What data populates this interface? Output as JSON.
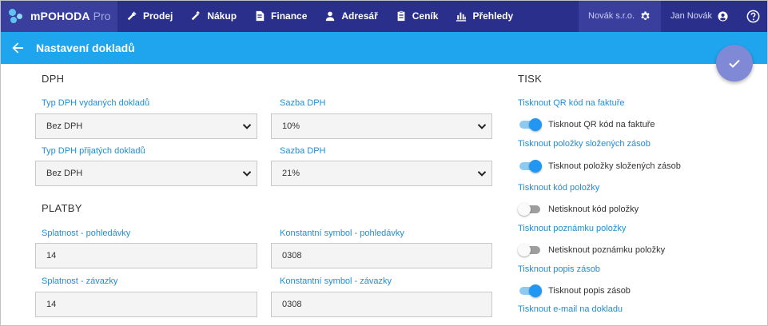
{
  "app": {
    "name": "mPOHODA",
    "edition": "Pro"
  },
  "nav": [
    {
      "label": "Prodej",
      "icon": "sales-icon"
    },
    {
      "label": "Nákup",
      "icon": "purchase-icon"
    },
    {
      "label": "Finance",
      "icon": "finance-icon"
    },
    {
      "label": "Adresář",
      "icon": "person-icon"
    },
    {
      "label": "Ceník",
      "icon": "pricelist-icon"
    },
    {
      "label": "Přehledy",
      "icon": "chart-icon"
    }
  ],
  "header": {
    "company": "Novák s.r.o.",
    "user": "Jan Novák"
  },
  "page": {
    "title": "Nastavení dokladů"
  },
  "dph": {
    "title": "DPH",
    "issued_type_label": "Typ DPH vydaných dokladů",
    "issued_type_value": "Bez DPH",
    "issued_rate_label": "Sazba DPH",
    "issued_rate_value": "10%",
    "received_type_label": "Typ DPH přijatých dokladů",
    "received_type_value": "Bez DPH",
    "received_rate_label": "Sazba DPH",
    "received_rate_value": "21%"
  },
  "platby": {
    "title": "PLATBY",
    "due_receivable_label": "Splatnost - pohledávky",
    "due_receivable_value": "14",
    "const_receivable_label": "Konstantní symbol - pohledávky",
    "const_receivable_value": "0308",
    "due_payable_label": "Splatnost - závazky",
    "due_payable_value": "14",
    "const_payable_label": "Konstantní symbol - závazky",
    "const_payable_value": "0308"
  },
  "tisk": {
    "title": "TISK",
    "items": [
      {
        "label": "Tisknout QR kód na faktuře",
        "state": "on",
        "text": "Tisknout QR kód na faktuře"
      },
      {
        "label": "Tisknout položky složených zásob",
        "state": "on",
        "text": "Tisknout položky složených zásob"
      },
      {
        "label": "Tisknout kód položky",
        "state": "off",
        "text": "Netisknout kód položky"
      },
      {
        "label": "Tisknout poznámku položky",
        "state": "off",
        "text": "Netisknout poznámku položky"
      },
      {
        "label": "Tisknout popis zásob",
        "state": "on",
        "text": "Tisknout popis zásob"
      }
    ],
    "last_label": "Tisknout e-mail na dokladu"
  }
}
